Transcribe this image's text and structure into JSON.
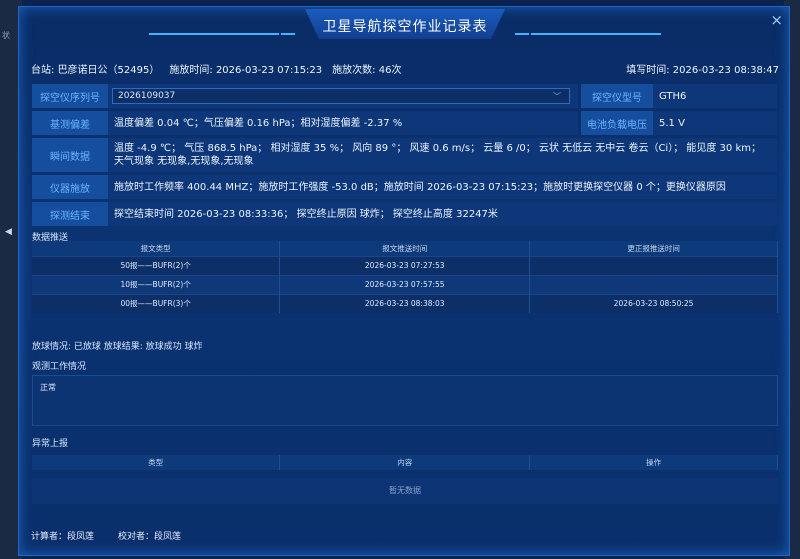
{
  "backdrop": {
    "side_text": "状",
    "arrow": "◀"
  },
  "modal": {
    "title": "卫星导航探空作业记录表",
    "close": "×"
  },
  "header": {
    "station_label": "台站:",
    "station_value": "巴彦诺日公（52495）",
    "release_time_label": "施放时间:",
    "release_time": "2026-03-23 07:15:23",
    "count_label": "施放次数:",
    "count_value": "46次",
    "fill_time_label": "填写时间:",
    "fill_time": "2026-03-23 08:38:47"
  },
  "fields": {
    "serial_label": "探空仪序列号",
    "serial_value": "2026109037",
    "model_label": "探空仪型号",
    "model_value": "GTH6",
    "baseline_label": "基测偏差",
    "baseline_value": "温度偏差 0.04 ℃；气压偏差 0.16 hPa；相对湿度偏差 -2.37 %",
    "voltage_label": "电池负载电压",
    "voltage_value": "5.1 V",
    "instant_label": "瞬间数据",
    "instant_value": "温度 -4.9 ℃；  气压 868.5 hPa；  相对湿度 35 %；  风向 89 °；  风速 0.6 m/s；  云量 6 /0；  云状 无低云 无中云 卷云（Ci）；  能见度 30 km；  天气现象 无现象,无现象,无现象",
    "instrument_label": "仪器施放",
    "instrument_value": "施放时工作频率 400.44 MHZ；施放时工作强度 -53.0 dB；施放时间 2026-03-23 07:15:23；施放时更换探空仪器 0 个；更换仪器原因",
    "end_label": "探测结束",
    "end_value": "探空结束时间 2026-03-23 08:33:36；  探空终止原因 球炸；  探空终止高度 32247米"
  },
  "push": {
    "title": "数据推送",
    "columns": [
      "报文类型",
      "报文推送时间",
      "更正报推送时间"
    ],
    "rows": [
      [
        "50报——BUFR(2)个",
        "2026-03-23 07:27:53",
        ""
      ],
      [
        "10报——BUFR(2)个",
        "2026-03-23 07:57:55",
        ""
      ],
      [
        "00报——BUFR(3)个",
        "2026-03-23 08:38:03",
        "2026-03-23 08:50:25"
      ]
    ]
  },
  "balloon": {
    "text": "放球情况:  已放球   放球结果:  放球成功   球炸"
  },
  "observation": {
    "title": "观测工作情况",
    "content": "正常"
  },
  "anomaly": {
    "title": "异常上报",
    "columns": [
      "类型",
      "内容",
      "操作"
    ],
    "empty": "暂无数据"
  },
  "footer": {
    "calculator": "计算者：段凤莲",
    "checker": "校对者：段凤莲"
  }
}
